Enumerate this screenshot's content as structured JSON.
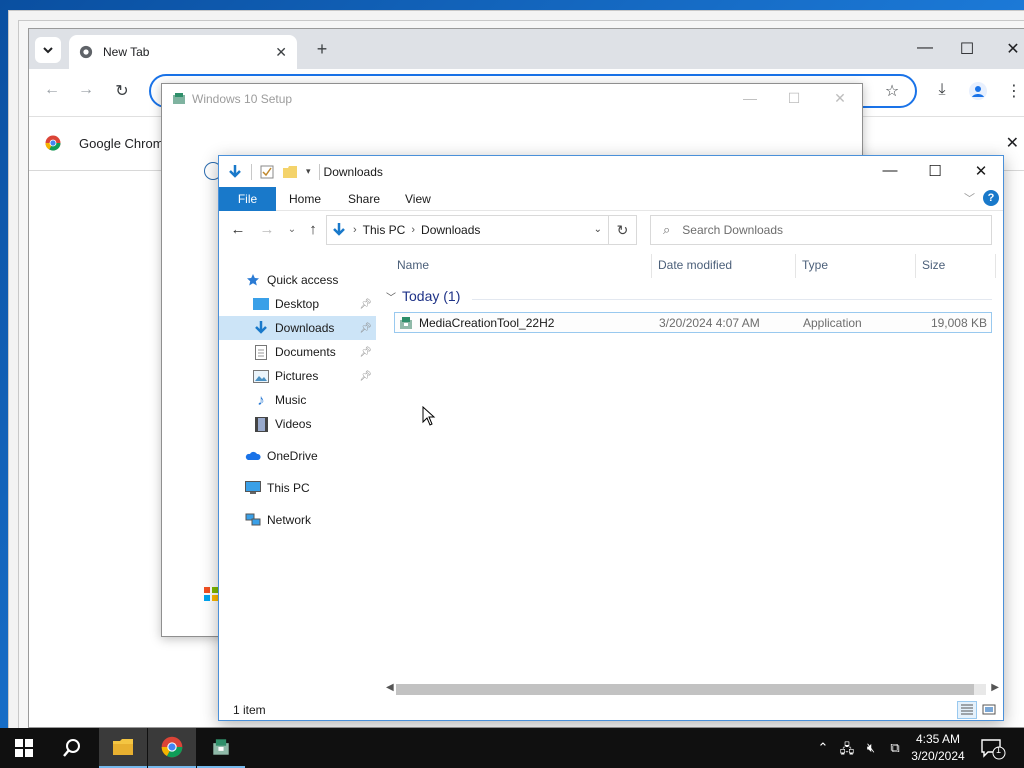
{
  "chrome": {
    "tab_title": "New Tab",
    "bookmark_label": "Google Chrom"
  },
  "setup": {
    "title": "Windows 10 Setup"
  },
  "explorer": {
    "title": "Downloads",
    "ribbon": {
      "file": "File",
      "home": "Home",
      "share": "Share",
      "view": "View",
      "help": "?"
    },
    "breadcrumb": [
      "This PC",
      "Downloads"
    ],
    "search_placeholder": "Search Downloads",
    "nav": {
      "quick_access": "Quick access",
      "desktop": "Desktop",
      "downloads": "Downloads",
      "documents": "Documents",
      "pictures": "Pictures",
      "music": "Music",
      "videos": "Videos",
      "onedrive": "OneDrive",
      "this_pc": "This PC",
      "network": "Network"
    },
    "columns": {
      "name": "Name",
      "date": "Date modified",
      "type": "Type",
      "size": "Size"
    },
    "group": "Today (1)",
    "files": [
      {
        "name": "MediaCreationTool_22H2",
        "date": "3/20/2024 4:07 AM",
        "type": "Application",
        "size": "19,008 KB"
      }
    ],
    "status": "1 item"
  },
  "taskbar": {
    "time": "4:35 AM",
    "date": "3/20/2024",
    "notification_count": "1"
  },
  "colors": {
    "accent": "#1979ca",
    "selection": "#cce4f7",
    "taskbar": "#101010"
  }
}
